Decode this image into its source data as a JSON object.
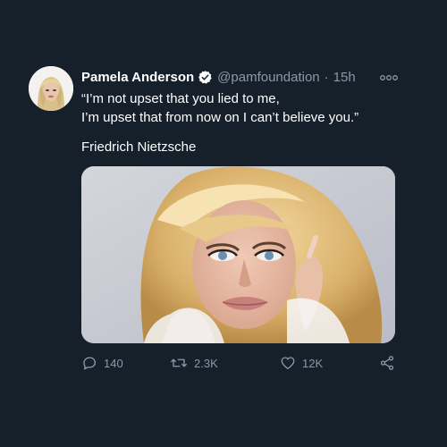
{
  "tweet": {
    "display_name": "Pamela Anderson",
    "handle": "@pamfoundation",
    "separator": "·",
    "time": "15h",
    "text_lines": [
      "“I’m not upset that you lied to me,",
      "I’m upset that from now on I can’t believe you.”"
    ],
    "attribution": "Friedrich Nietzsche",
    "verified": true,
    "media": {
      "description_icon": "photo-portrait"
    }
  },
  "actions": {
    "reply_count": "140",
    "retweet_count": "2.3K",
    "like_count": "12K",
    "icons": [
      "reply-icon",
      "retweet-icon",
      "like-icon",
      "share-icon"
    ]
  },
  "colors": {
    "background": "#15202b",
    "text": "#ffffff",
    "secondary_text": "#8b98a5",
    "verified_badge": "#ffffff"
  }
}
